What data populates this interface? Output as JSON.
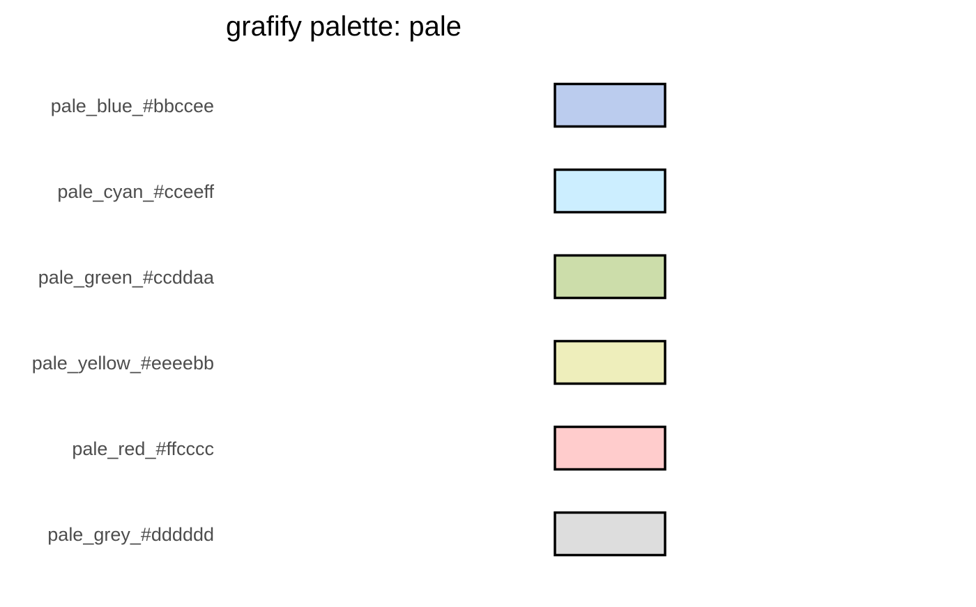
{
  "chart_data": {
    "type": "table",
    "title": "grafify palette: pale",
    "xlabel": "",
    "ylabel": "",
    "grid": false,
    "legend": "none",
    "categories": [
      "pale_blue_#bbccee",
      "pale_cyan_#cceeff",
      "pale_green_#ccddaa",
      "pale_yellow_#eeeebb",
      "pale_red_#ffcccc",
      "pale_grey_#dddddd"
    ],
    "colors": [
      "#bbccee",
      "#cceeff",
      "#ccddaa",
      "#eeeebb",
      "#ffcccc",
      "#dddddd"
    ]
  }
}
